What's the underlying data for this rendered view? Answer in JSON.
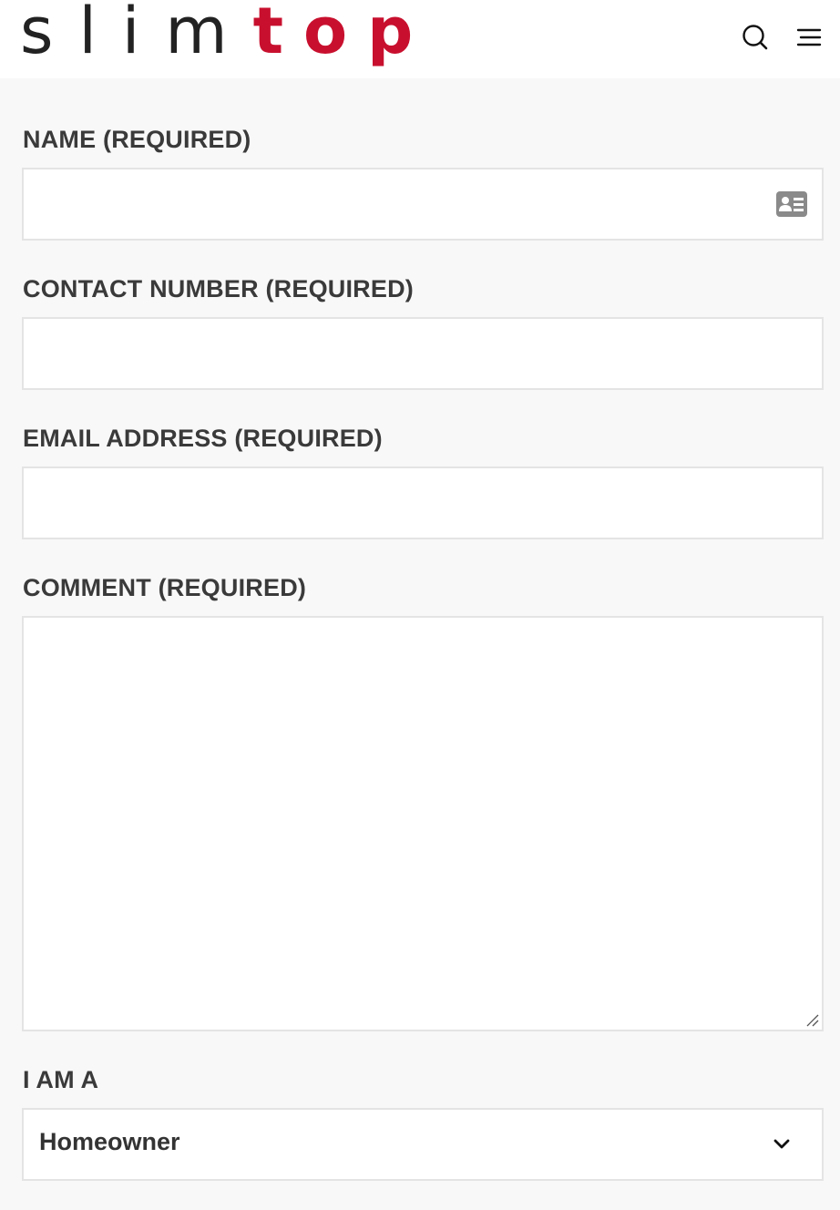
{
  "header": {
    "logo": {
      "part_a": "slim",
      "part_b": "top"
    },
    "icons": {
      "search": "search-icon",
      "menu": "hamburger-menu-icon"
    },
    "colors": {
      "brand_red": "#c8102e",
      "logo_dark": "#222222"
    }
  },
  "form": {
    "name": {
      "label": "NAME (REQUIRED)",
      "value": "",
      "icon": "contact-card-icon"
    },
    "contact": {
      "label": "CONTACT NUMBER (REQUIRED)",
      "value": ""
    },
    "email": {
      "label": "EMAIL ADDRESS (REQUIRED)",
      "value": ""
    },
    "comment": {
      "label": "COMMENT (REQUIRED)",
      "value": ""
    },
    "role": {
      "label": "I AM A",
      "selected": "Homeowner",
      "icon": "chevron-down-icon"
    }
  }
}
